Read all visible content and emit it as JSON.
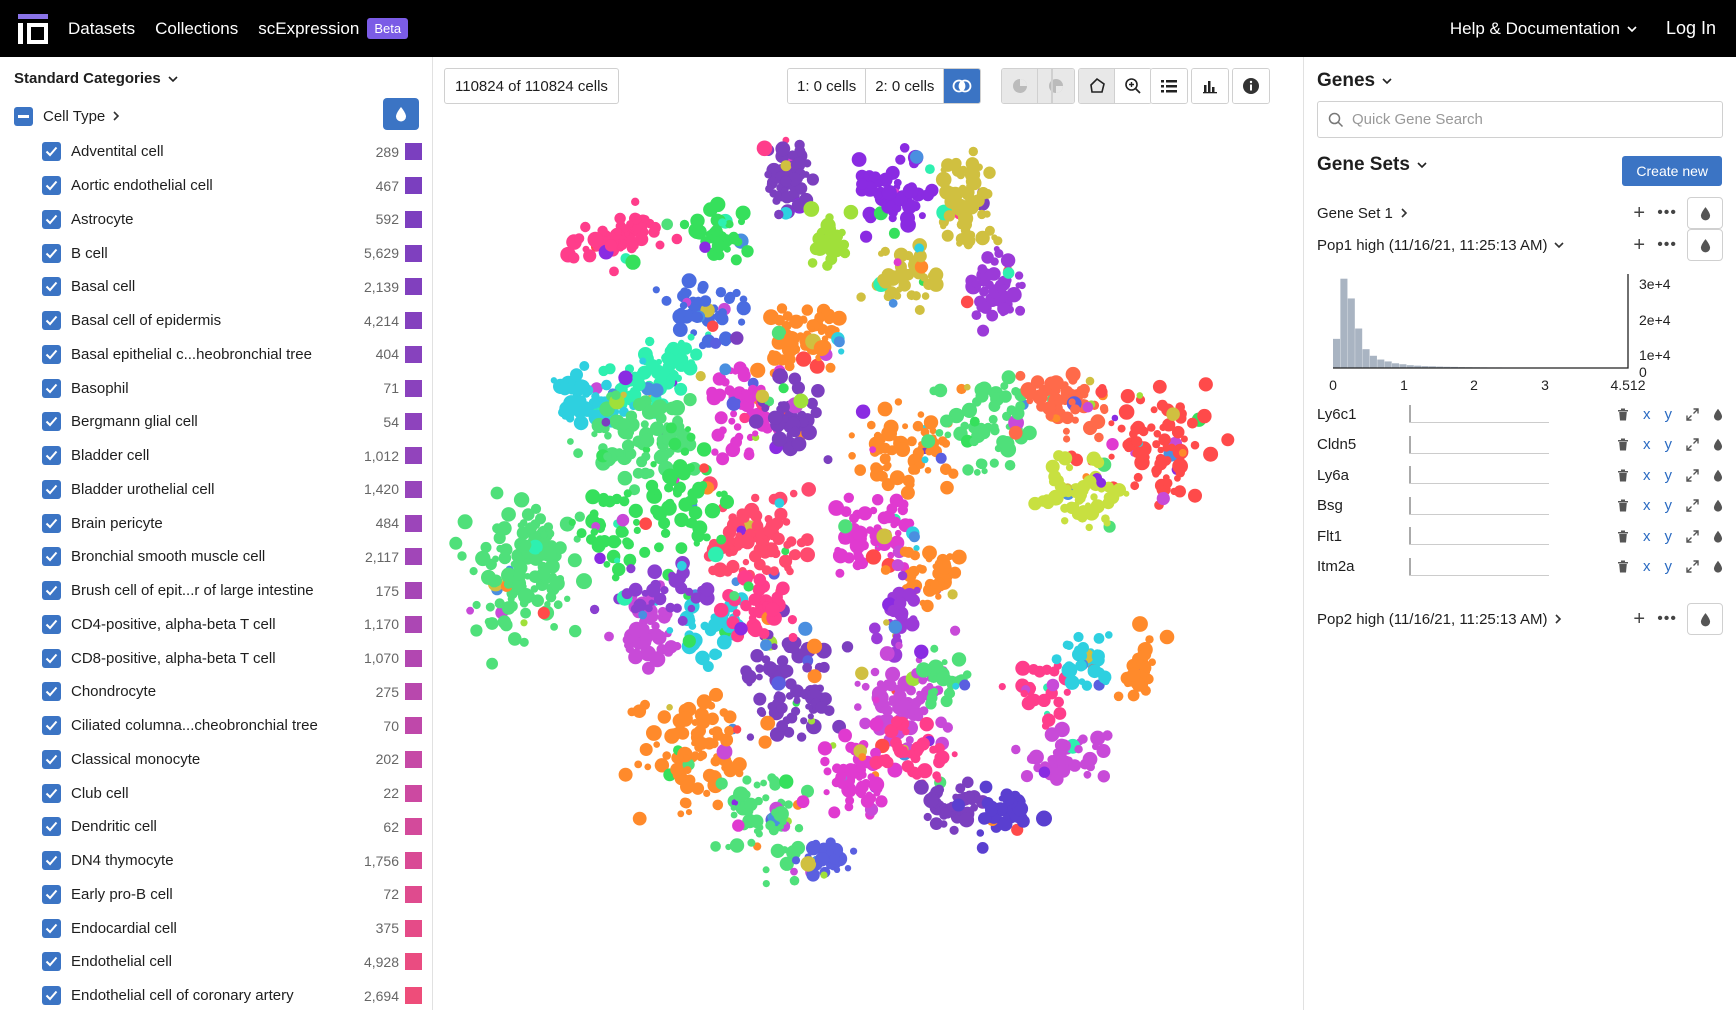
{
  "nav": {
    "datasets": "Datasets",
    "collections": "Collections",
    "scexpression": "scExpression",
    "beta": "Beta",
    "help": "Help & Documentation",
    "login": "Log In"
  },
  "categories_panel": {
    "title": "Standard Categories",
    "field": "Cell Type",
    "items": [
      {
        "name": "Adventital cell",
        "count": "289",
        "color": "#7b3fbf"
      },
      {
        "name": "Aortic endothelial cell",
        "count": "467",
        "color": "#7b3fbf"
      },
      {
        "name": "Astrocyte",
        "count": "592",
        "color": "#7d3fbf"
      },
      {
        "name": "B cell",
        "count": "5,629",
        "color": "#7f40bf"
      },
      {
        "name": "Basal cell",
        "count": "2,139",
        "color": "#8140be"
      },
      {
        "name": "Basal cell of epidermis",
        "count": "4,214",
        "color": "#8441be"
      },
      {
        "name": "Basal epithelial c...heobronchial tree",
        "count": "404",
        "color": "#8742be"
      },
      {
        "name": "Basophil",
        "count": "71",
        "color": "#8a42bd"
      },
      {
        "name": "Bergmann glial cell",
        "count": "54",
        "color": "#8e43bd"
      },
      {
        "name": "Bladder cell",
        "count": "1,012",
        "color": "#9244bc"
      },
      {
        "name": "Bladder urothelial cell",
        "count": "1,420",
        "color": "#9745bb"
      },
      {
        "name": "Brain pericyte",
        "count": "484",
        "color": "#9c45ba"
      },
      {
        "name": "Bronchial smooth muscle cell",
        "count": "2,117",
        "color": "#a146b8"
      },
      {
        "name": "Brush cell of epit...r of large intestine",
        "count": "175",
        "color": "#a646b6"
      },
      {
        "name": "CD4-positive, alpha-beta T cell",
        "count": "1,170",
        "color": "#ac47b4"
      },
      {
        "name": "CD8-positive, alpha-beta T cell",
        "count": "1,070",
        "color": "#b247b1"
      },
      {
        "name": "Chondrocyte",
        "count": "275",
        "color": "#b848ad"
      },
      {
        "name": "Ciliated columna...cheobronchial tree",
        "count": "70",
        "color": "#bf48aa"
      },
      {
        "name": "Classical monocyte",
        "count": "202",
        "color": "#c649a6"
      },
      {
        "name": "Club cell",
        "count": "22",
        "color": "#cc49a1"
      },
      {
        "name": "Dendritic cell",
        "count": "62",
        "color": "#d34a9b"
      },
      {
        "name": "DN4 thymocyte",
        "count": "1,756",
        "color": "#d94a95"
      },
      {
        "name": "Early pro-B cell",
        "count": "72",
        "color": "#df4b8e"
      },
      {
        "name": "Endocardial cell",
        "count": "375",
        "color": "#e54b88"
      },
      {
        "name": "Endothelial cell",
        "count": "4,928",
        "color": "#ea4c81"
      },
      {
        "name": "Endothelial cell of coronary artery",
        "count": "2,694",
        "color": "#ee4d7a"
      }
    ]
  },
  "toolbar": {
    "cell_count": "110824 of 110824 cells",
    "sel1": "1: 0 cells",
    "sel2": "2: 0 cells"
  },
  "genes_panel": {
    "title": "Genes",
    "search_placeholder": "Quick Gene Search",
    "gene_sets_title": "Gene Sets",
    "create_new": "Create new",
    "sets": [
      {
        "name": "Gene Set 1"
      },
      {
        "name": "Pop1 high (11/16/21, 11:25:13 AM)"
      },
      {
        "name": "Pop2 high (11/16/21, 11:25:13 AM)"
      }
    ],
    "genes": [
      "Ly6c1",
      "Cldn5",
      "Ly6a",
      "Bsg",
      "Flt1",
      "Itm2a"
    ],
    "gene_actions": {
      "x": "x",
      "y": "y"
    },
    "histogram": {
      "x_ticks": [
        "0",
        "1",
        "2",
        "3",
        "4.512"
      ],
      "y_ticks": [
        "3e+4",
        "2e+4",
        "1e+4",
        "0"
      ],
      "bar_fractions": [
        0.31,
        0.95,
        0.74,
        0.42,
        0.2,
        0.13,
        0.09,
        0.07,
        0.05,
        0.04,
        0.03,
        0.025,
        0.02,
        0.018,
        0.015,
        0.013,
        0.012,
        0.01,
        0.009,
        0.008,
        0.007,
        0.006,
        0.006,
        0.005,
        0.005,
        0.004,
        0.004,
        0.003,
        0.003,
        0.003,
        0.002,
        0.002,
        0.002,
        0.002,
        0.001,
        0.001,
        0.001,
        0.001,
        0.001,
        0.001
      ]
    }
  },
  "colors": {
    "accent": "#3b74c4",
    "beta": "#7b5ce6"
  }
}
